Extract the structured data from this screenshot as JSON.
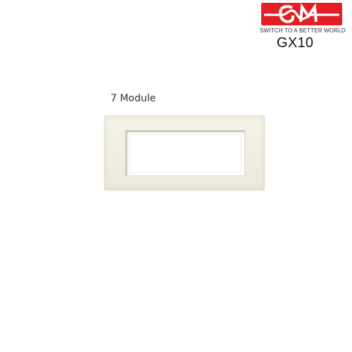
{
  "brand": {
    "logo_text": "GM",
    "tagline": "SWITCH TO A BETTER WORLD",
    "color": "#e31e24"
  },
  "product": {
    "model": "GX10",
    "module_label": "7 Module",
    "plate_color": "#f3f1e4"
  }
}
